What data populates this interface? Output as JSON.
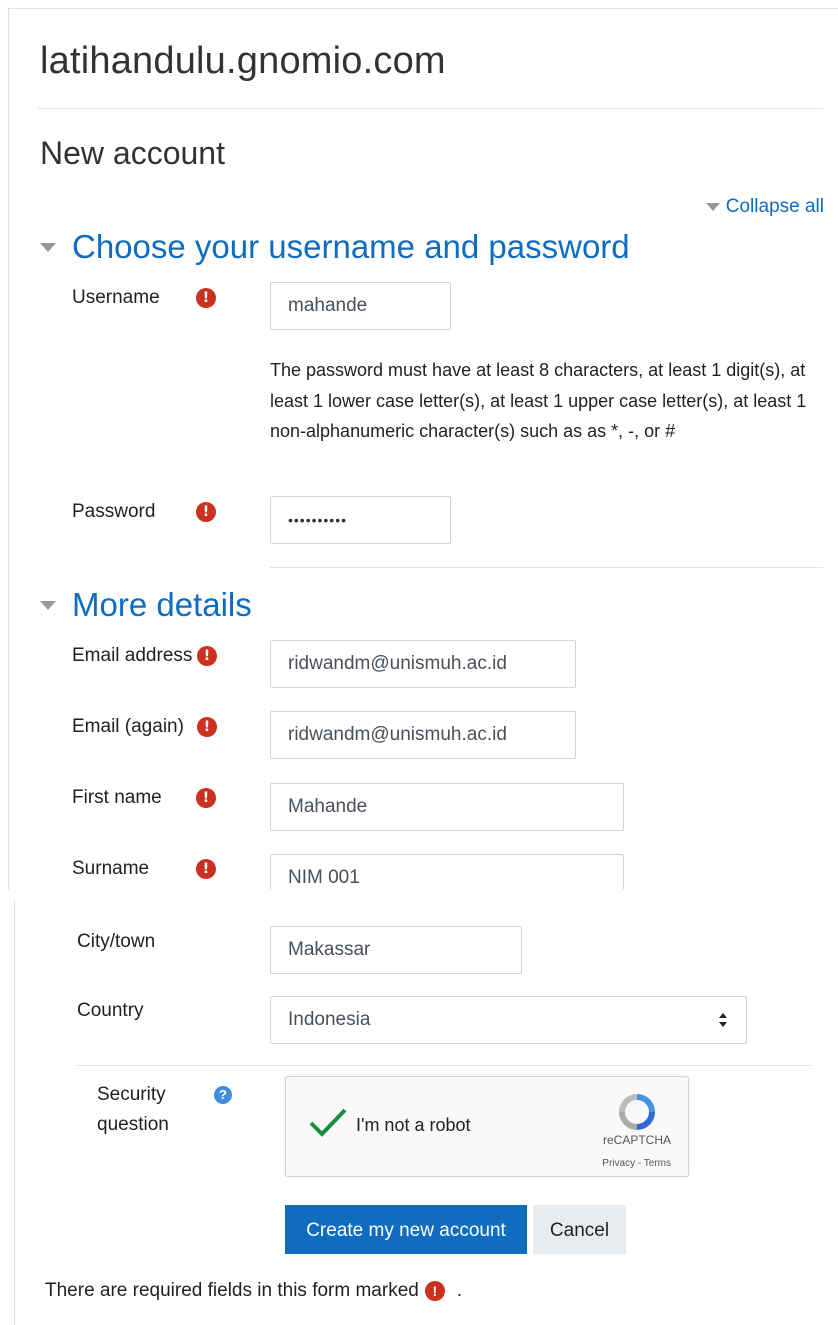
{
  "site": {
    "title": "latihandulu.gnomio.com"
  },
  "page": {
    "title": "New account",
    "collapse_all": "Collapse all"
  },
  "sections": {
    "credentials": {
      "title": "Choose your username and password"
    },
    "details": {
      "title": "More details"
    }
  },
  "fields": {
    "username": {
      "label": "Username",
      "value": "mahande",
      "required": true
    },
    "password_policy": "The password must have at least 8 characters, at least 1 digit(s), at least 1 lower case letter(s), at least 1 upper case letter(s), at least 1 non-alphanumeric character(s) such as as *, -, or #",
    "password": {
      "label": "Password",
      "value": "••••••••••",
      "required": true
    },
    "email": {
      "label": "Email address",
      "value": "ridwandm@unismuh.ac.id",
      "required": true
    },
    "email_again": {
      "label": "Email (again)",
      "value": "ridwandm@unismuh.ac.id",
      "required": true
    },
    "first_name": {
      "label": "First name",
      "value": "Mahande",
      "required": true
    },
    "surname": {
      "label": "Surname",
      "value": "NIM 001",
      "required": true
    },
    "city": {
      "label": "City/town",
      "value": "Makassar"
    },
    "country": {
      "label": "Country",
      "value": "Indonesia"
    }
  },
  "security": {
    "label": "Security question",
    "captcha_text": "I'm not a robot",
    "captcha_brand": "reCAPTCHA",
    "captcha_links": "Privacy - Terms"
  },
  "buttons": {
    "create": "Create my new account",
    "cancel": "Cancel"
  },
  "footer": {
    "required_note": "There are required fields in this form marked",
    "period": "."
  },
  "icons": {
    "required": "exclamation-circle-icon",
    "help": "question-circle-icon",
    "collapse": "triangle-down-icon",
    "captcha_check": "check-icon",
    "captcha_logo": "recaptcha-logo-icon"
  },
  "colors": {
    "accent": "#0f6cbf",
    "required": "#ca3120",
    "check": "#1e8e3e"
  }
}
